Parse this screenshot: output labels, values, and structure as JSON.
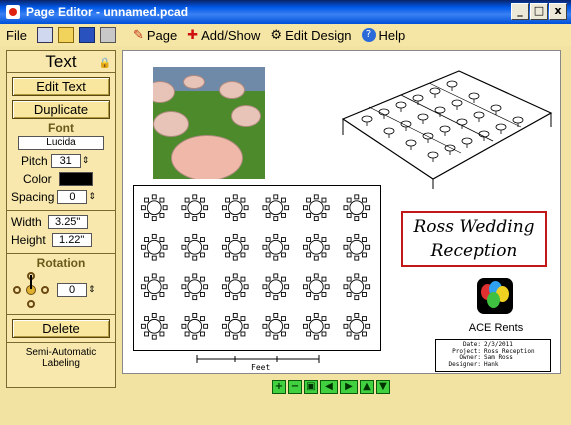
{
  "window": {
    "title": "Page Editor - unnamed.pcad",
    "min": "_",
    "max": "□",
    "close": "x"
  },
  "menu": {
    "file": "File",
    "page": "Page",
    "add_show": "Add/Show",
    "edit_design": "Edit Design",
    "help": "Help"
  },
  "panel": {
    "title": "Text",
    "edit_text": "Edit Text",
    "duplicate": "Duplicate",
    "font_head": "Font",
    "font_name": "Lucida",
    "pitch_label": "Pitch",
    "pitch_value": "31",
    "color_label": "Color",
    "color_value": "#000000",
    "spacing_label": "Spacing",
    "spacing_value": "0",
    "width_label": "Width",
    "width_value": "3.25\"",
    "height_label": "Height",
    "height_value": "1.22\"",
    "rotation_head": "Rotation",
    "rotation_value": "0",
    "delete": "Delete",
    "footer_line1": "Semi-Automatic",
    "footer_line2": "Labeling"
  },
  "canvas": {
    "title_line1": "Ross Wedding",
    "title_line2": "Reception",
    "logo_text": "ACE Rents",
    "scale_label": "Feet",
    "info": [
      {
        "k": "Date:",
        "v": "2/3/2011"
      },
      {
        "k": "Project:",
        "v": "Ross Reception"
      },
      {
        "k": "Owner:",
        "v": "Sam Ross"
      },
      {
        "k": "Designer:",
        "v": "Hank"
      }
    ]
  },
  "colors": {
    "menu_bg": "#f5e6a6",
    "workspace": "#f3e3a3",
    "nav_green": "#40d040",
    "title_border": "#c01818"
  },
  "icons": [
    "app-icon",
    "new-file-icon",
    "open-folder-icon",
    "save-disk-icon",
    "print-icon",
    "lock-icon",
    "zoom-in-icon",
    "zoom-out-icon",
    "zoom-fit-icon",
    "arrow-left-icon",
    "arrow-right-icon",
    "arrow-up-icon",
    "arrow-down-icon"
  ]
}
